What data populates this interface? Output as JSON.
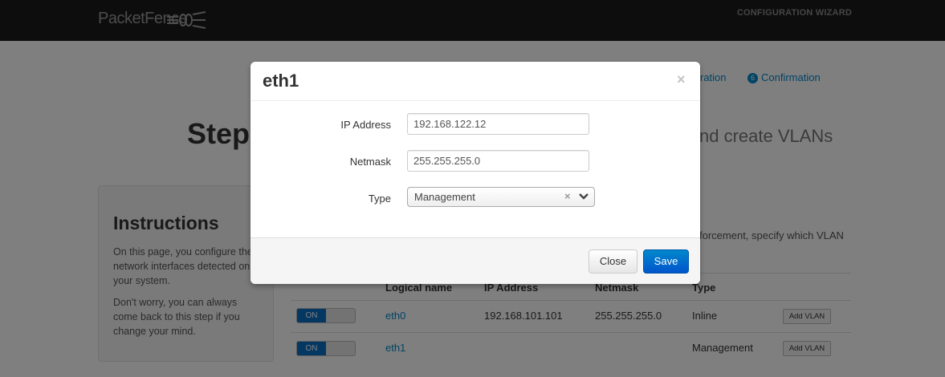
{
  "app": {
    "brand": "PacketFence",
    "wizard_label": "CONFIGURATION WIZARD"
  },
  "background": {
    "steps": [
      {
        "label": "ration"
      },
      {
        "number": "6",
        "label": "Confirmation"
      }
    ],
    "step_title": "Step",
    "step_subtitle": "nd create VLANs",
    "instructions": {
      "heading": "Instructions",
      "paragraph1": "On this page, you configure the network interfaces detected on your system.",
      "paragraph2": "Don't worry, you can always come back to this step if you change your mind."
    },
    "enforcement_text": "forcement, specify which VLAN",
    "table": {
      "headers": [
        "Logical name",
        "IP Address",
        "Netmask",
        "Type"
      ],
      "rows": [
        {
          "toggle": "ON",
          "name": "eth0",
          "ip": "192.168.101.101",
          "netmask": "255.255.255.0",
          "type": "Inline",
          "action": "Add VLAN"
        },
        {
          "toggle": "ON",
          "name": "eth1",
          "ip": "",
          "netmask": "",
          "type": "Management",
          "action": "Add VLAN"
        }
      ]
    }
  },
  "modal": {
    "title": "eth1",
    "close_symbol": "×",
    "fields": {
      "ip_label": "IP Address",
      "ip_value": "192.168.122.12",
      "netmask_label": "Netmask",
      "netmask_value": "255.255.255.0",
      "type_label": "Type",
      "type_value": "Management",
      "type_clear": "×"
    },
    "buttons": {
      "close": "Close",
      "save": "Save"
    }
  }
}
